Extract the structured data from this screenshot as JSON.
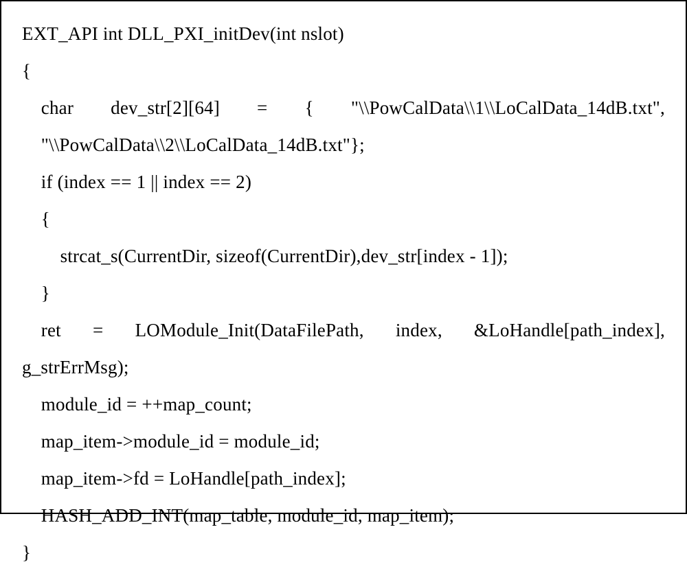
{
  "code": {
    "l1": "EXT_API int DLL_PXI_initDev(int nslot)",
    "l2": "{",
    "l3a": "    char",
    "l3b": "dev_str[2][64]",
    "l3c": "=",
    "l3d": "{",
    "l3e": "\"\\\\PowCalData\\\\1\\\\LoCalData_14dB.txt\",",
    "l4": "    \"\\\\PowCalData\\\\2\\\\LoCalData_14dB.txt\"};",
    "l5": "    if (index == 1 || index == 2)",
    "l6": "    {",
    "l7": "        strcat_s(CurrentDir, sizeof(CurrentDir),dev_str[index - 1]);",
    "l8": "    }",
    "l9a": "    ret",
    "l9b": "=",
    "l9c": "LOModule_Init(DataFilePath,",
    "l9d": "index,",
    "l9e": "&LoHandle[path_index],",
    "l10": "g_strErrMsg);",
    "l11": "    module_id = ++map_count;",
    "l12": "    map_item->module_id = module_id;",
    "l13": "    map_item->fd = LoHandle[path_index];",
    "l14": "    HASH_ADD_INT(map_table, module_id, map_item);",
    "l15": "}"
  }
}
